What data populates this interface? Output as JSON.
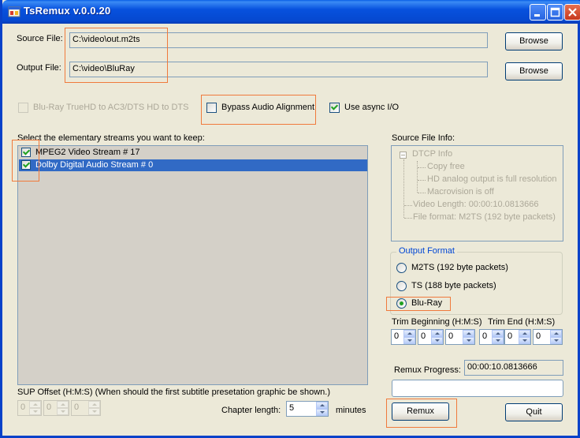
{
  "window": {
    "title": "TsRemux v.0.0.20"
  },
  "source": {
    "label": "Source File:",
    "value": "C:\\video\\out.m2ts",
    "browse": "Browse"
  },
  "output": {
    "label": "Output File:",
    "value": "C:\\video\\BluRay",
    "browse": "Browse"
  },
  "options": {
    "truehd": "Blu-Ray TrueHD to AC3/DTS HD to DTS",
    "bypass_audio": "Bypass Audio Alignment",
    "async_io": "Use async I/O"
  },
  "streams": {
    "label": "Select the elementary streams you want to keep:",
    "items": [
      "MPEG2 Video Stream # 17",
      "Dolby Digital Audio Stream # 0"
    ]
  },
  "info": {
    "label": "Source File Info:",
    "root": "DTCP Info",
    "children": [
      "Copy free",
      "HD analog output is full resolution",
      "Macrovision is off"
    ],
    "video_length": "Video Length: 00:00:10.0813666",
    "file_format": "File format: M2TS (192 byte packets)"
  },
  "output_format": {
    "title": "Output Format",
    "options": [
      "M2TS (192 byte packets)",
      "TS (188 byte packets)",
      "Blu-Ray"
    ]
  },
  "trim": {
    "begin_label": "Trim Beginning (H:M:S)",
    "end_label": "Trim End (H:M:S)",
    "begin": [
      "0",
      "0",
      "0"
    ],
    "end": [
      "0",
      "0",
      "0"
    ]
  },
  "progress": {
    "label": "Remux Progress:",
    "time": "00:00:10.0813666",
    "fraction": 0
  },
  "sup": {
    "label": "SUP Offset (H:M:S) (When should the first subtitle presetation graphic be shown.)",
    "values": [
      "0",
      "0",
      "0"
    ]
  },
  "chapter": {
    "label": "Chapter length:",
    "value": "5",
    "unit": "minutes"
  },
  "actions": {
    "remux": "Remux",
    "quit": "Quit"
  },
  "colors": {
    "title_bar": "#0751DE",
    "selection": "#316AC5",
    "highlight": "#F07A3C",
    "check": "#21A121"
  }
}
